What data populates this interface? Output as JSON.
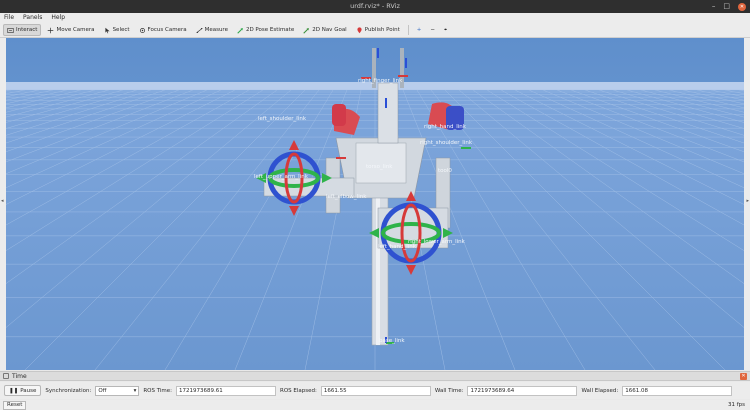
{
  "window": {
    "title": "urdf.rviz* - RViz"
  },
  "menu": [
    {
      "label": "File"
    },
    {
      "label": "Panels"
    },
    {
      "label": "Help"
    }
  ],
  "toolbar": {
    "tools": [
      {
        "label": "Interact",
        "icon": "interact-icon"
      },
      {
        "label": "Move Camera",
        "icon": "move-camera-icon"
      },
      {
        "label": "Select",
        "icon": "select-icon"
      },
      {
        "label": "Focus Camera",
        "icon": "focus-camera-icon"
      },
      {
        "label": "Measure",
        "icon": "measure-icon"
      },
      {
        "label": "2D Pose Estimate",
        "icon": "pose-estimate-icon"
      },
      {
        "label": "2D Nav Goal",
        "icon": "nav-goal-icon"
      },
      {
        "label": "Publish Point",
        "icon": "publish-point-icon"
      }
    ],
    "extras": [
      "+",
      "−",
      "⌖"
    ]
  },
  "scene": {
    "labels": [
      "right_finger_link",
      "base_link",
      "left_shoulder_link",
      "left_upper_arm_link",
      "right_hand_link",
      "right_lower_arm_link",
      "left_elbow_link",
      "torso_link",
      "right_shoulder_link",
      "left_hand_link",
      "tool0"
    ],
    "colors": {
      "sky": "#5f8fcc",
      "horizon": "#a8c0e6",
      "grid": "#a3bfe3",
      "robot": "#d8dde4",
      "axis_x": "#d63a3a",
      "axis_y": "#2fb34a",
      "axis_z": "#2a4fd6"
    }
  },
  "time_panel": {
    "title": "Time",
    "pause_label": "Pause",
    "sync_label": "Synchronization:",
    "sync_value": "Off",
    "ros_time_label": "ROS Time:",
    "ros_time_value": "1721973689.61",
    "ros_elapsed_label": "ROS Elapsed:",
    "ros_elapsed_value": "1661.55",
    "wall_time_label": "Wall Time:",
    "wall_time_value": "1721973689.64",
    "wall_elapsed_label": "Wall Elapsed:",
    "wall_elapsed_value": "1661.08"
  },
  "status": {
    "reset_label": "Reset",
    "fps": "31 fps"
  }
}
